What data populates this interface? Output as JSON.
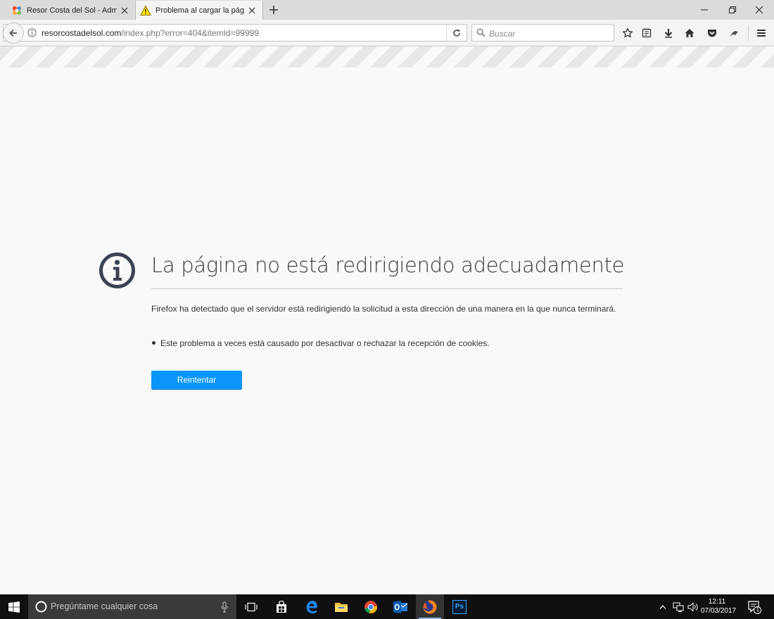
{
  "browser": {
    "tabs": [
      {
        "label": "Resor Costa del Sol - Adm...",
        "active": false,
        "icon": "joomla-icon"
      },
      {
        "label": "Problema al cargar la pági...",
        "active": true,
        "icon": "warning-icon"
      }
    ],
    "url": {
      "host": "resorcostadelsol.com",
      "path": "/index.php?error=404&itemId=99999"
    },
    "search": {
      "placeholder": "Buscar"
    },
    "colors": {
      "accent": "#0996f8",
      "tab_bar": "#dbdbdb",
      "toolbar": "#f4f4f4"
    }
  },
  "error_page": {
    "title": "La página no está redirigiendo adecuadamente",
    "description": "Firefox ha detectado que el servidor está redirigiendo la solicitud a esta dirección de una manera en la que nunca terminará.",
    "bullets": [
      "Este problema a veces está causado por desactivar o rechazar la recepción de cookies."
    ],
    "retry_label": "Reintentar"
  },
  "taskbar": {
    "search_placeholder": "Pregúntame cualquier cosa",
    "apps": [
      "task-view",
      "store",
      "edge",
      "file-explorer",
      "chrome",
      "outlook",
      "firefox",
      "photoshop"
    ],
    "photoshop_label": "Ps",
    "clock": {
      "time": "12:11",
      "date": "07/03/2017"
    },
    "notification_count": "1"
  }
}
